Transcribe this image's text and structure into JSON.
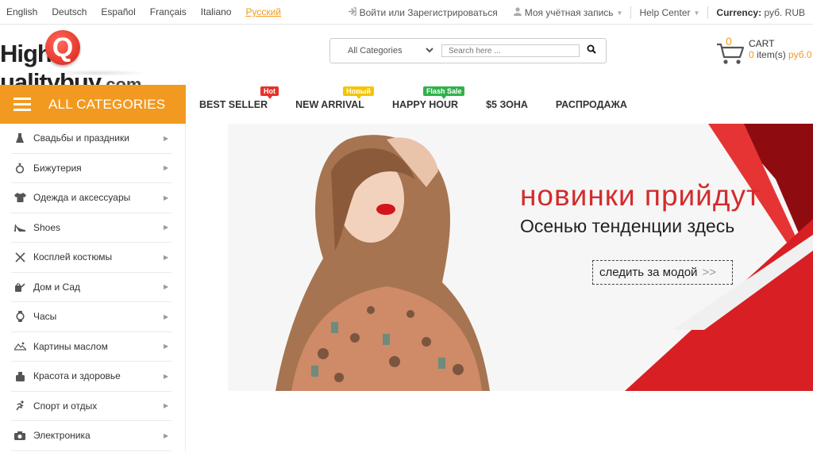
{
  "languages": [
    "English",
    "Deutsch",
    "Español",
    "Français",
    "Italiano",
    "Русский"
  ],
  "active_language": "Русский",
  "account": {
    "login": "Войти или Зарегистрироваться",
    "my_account": "Моя учётная запись",
    "help": "Help Center",
    "currency_label": "Currency:",
    "currency_value": "руб. RUB"
  },
  "logo": {
    "part1": "High",
    "q": "Q",
    "part2": "ualitybuy",
    "tld": ".com"
  },
  "search": {
    "category": "All Categories",
    "placeholder": "Search here ..."
  },
  "cart": {
    "count": "0",
    "label": "CART",
    "items_count": "0",
    "items_text": "item(s)",
    "total": "руб.0"
  },
  "all_categories": "ALL CATEGORIES",
  "nav": [
    {
      "label": "BEST SELLER",
      "badge": "Hot"
    },
    {
      "label": "NEW ARRIVAL",
      "badge": "Новый"
    },
    {
      "label": "HAPPY HOUR",
      "badge": "Flash Sale"
    },
    {
      "label": "$5 ЗОНА",
      "badge": ""
    },
    {
      "label": "РАСПРОДАЖА",
      "badge": ""
    }
  ],
  "badge_colors": {
    "Hot": "#e8312b",
    "Новый": "#f5c400",
    "Flash Sale": "#2fb24a"
  },
  "sidebar": [
    {
      "label": "Свадьбы и праздники",
      "icon": "dress-icon"
    },
    {
      "label": "Бижутерия",
      "icon": "ring-icon"
    },
    {
      "label": "Одежда и аксессуары",
      "icon": "tshirt-icon"
    },
    {
      "label": "Shoes",
      "icon": "heel-shoe-icon"
    },
    {
      "label": "Косплей костюмы",
      "icon": "crossed-swords-icon"
    },
    {
      "label": "Дом и Сад",
      "icon": "watering-can-icon"
    },
    {
      "label": "Часы",
      "icon": "watch-icon"
    },
    {
      "label": "Картины маслом",
      "icon": "landscape-icon"
    },
    {
      "label": "Красота и здоровье",
      "icon": "cosmetics-icon"
    },
    {
      "label": "Спорт и отдых",
      "icon": "runner-icon"
    },
    {
      "label": "Электроника",
      "icon": "camera-icon"
    }
  ],
  "banner": {
    "headline": "новинки прийдут",
    "subline": "Осенью тенденции здесь",
    "cta": "следить за модой",
    "cta_arrows": ">>"
  },
  "colors": {
    "accent": "#f29a1f",
    "banner_red": "#d42b2b"
  }
}
